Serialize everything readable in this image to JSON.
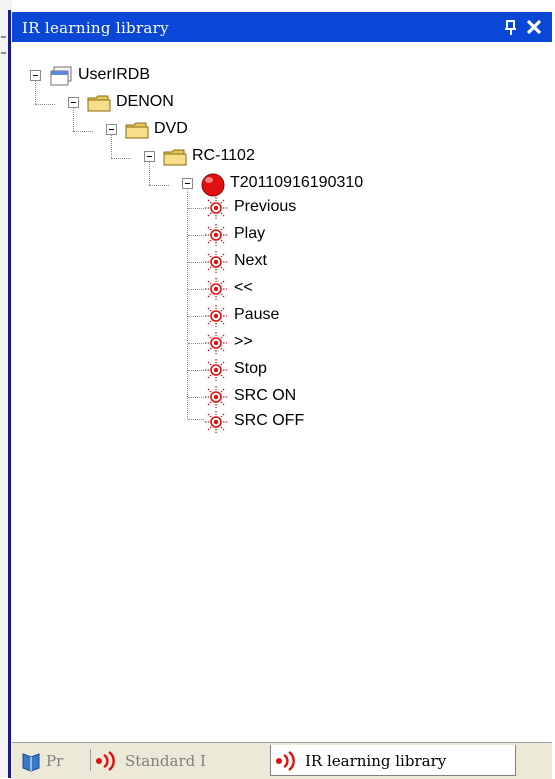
{
  "panel": {
    "title": "IR learning library",
    "colors": {
      "titlebar": "#0a47d6",
      "left_edge": "#1a1a8c",
      "tab_bar": "#ece9d8"
    }
  },
  "tree": {
    "root": "UserIRDB",
    "brand": "DENON",
    "category": "DVD",
    "model": "RC-1102",
    "session": "T20110916190310",
    "commands": [
      "Previous",
      "Play",
      "Next",
      "<<",
      "Pause",
      ">>",
      "Stop",
      "SRC ON",
      "SRC OFF"
    ]
  },
  "tabs": [
    {
      "label": "Pr",
      "icon": "book-icon",
      "active": false
    },
    {
      "label": "Standard I",
      "icon": "ir-signal-icon",
      "active": false
    },
    {
      "label": "IR learning library",
      "icon": "ir-signal-icon",
      "active": true
    }
  ]
}
